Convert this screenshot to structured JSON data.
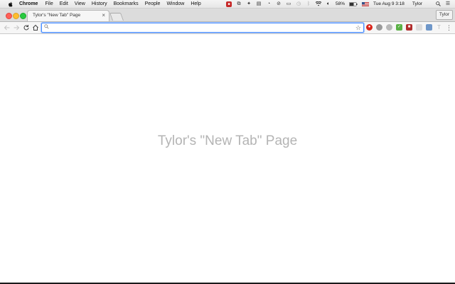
{
  "menubar": {
    "app_name": "Chrome",
    "menus": [
      "File",
      "Edit",
      "View",
      "History",
      "Bookmarks",
      "People",
      "Window",
      "Help"
    ],
    "battery_text": "58%",
    "datetime": "Tue Aug 9  3:18",
    "user": "Tylor"
  },
  "tab": {
    "title": "Tylor's \"New Tab\" Page",
    "close_glyph": "×"
  },
  "profile": {
    "label": "Tylor"
  },
  "omnibox": {
    "value": "",
    "placeholder": ""
  },
  "page": {
    "heading": "Tylor's \"New Tab\" Page"
  },
  "colors": {
    "traffic_close": "#ff5f57",
    "traffic_minimize": "#ffbd2e",
    "traffic_maximize": "#28c940",
    "omnibox_focus": "#4d90fe",
    "heading": "#b4b4b4"
  }
}
